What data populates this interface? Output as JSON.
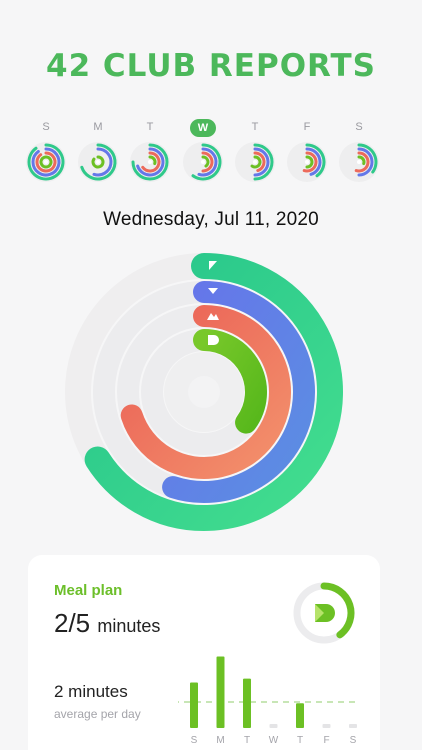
{
  "app": {
    "title": "42 CLUB REPORTS"
  },
  "week": {
    "days": [
      {
        "letter": "S",
        "active": false,
        "rings": [
          0.9,
          0.9,
          0.9,
          1.0
        ]
      },
      {
        "letter": "M",
        "active": false,
        "rings": [
          0.7,
          0.55,
          0.0,
          0.85
        ]
      },
      {
        "letter": "T",
        "active": false,
        "rings": [
          0.75,
          0.7,
          0.65,
          0.3
        ]
      },
      {
        "letter": "W",
        "active": true,
        "rings": [
          0.6,
          0.55,
          0.5,
          0.4
        ]
      },
      {
        "letter": "T",
        "active": false,
        "rings": [
          0.5,
          0.5,
          0.45,
          0.6
        ]
      },
      {
        "letter": "F",
        "active": false,
        "rings": [
          0.4,
          0.45,
          0.55,
          0.5
        ]
      },
      {
        "letter": "S",
        "active": false,
        "rings": [
          0.35,
          0.5,
          0.55,
          0.3
        ]
      }
    ]
  },
  "date_heading": "Wednesday, Jul 11, 2020",
  "activity": {
    "rings": [
      {
        "name": "outer",
        "fraction": 0.66,
        "color_start": "#25c48b",
        "color_end": "#3ddc8e"
      },
      {
        "name": "second",
        "fraction": 0.55,
        "color_start": "#6477e8",
        "color_end": "#5a8be0"
      },
      {
        "name": "third",
        "fraction": 0.7,
        "color_start": "#ec6a5b",
        "color_end": "#f2876a"
      },
      {
        "name": "inner",
        "fraction": 0.35,
        "color_start": "#6cc024",
        "color_end": "#56b81e"
      }
    ],
    "track_color": "#ececee"
  },
  "meal_card": {
    "label": "Meal plan",
    "value_main": "2/5",
    "value_unit": "minutes",
    "progress": 0.4,
    "avg_value": "2 minutes",
    "avg_caption": "average per day"
  },
  "chart_data": {
    "type": "bar",
    "categories": [
      "S",
      "M",
      "T",
      "W",
      "T",
      "F",
      "S"
    ],
    "values": [
      3.5,
      5.5,
      3.8,
      0,
      1.9,
      0,
      0
    ],
    "average": 2,
    "ylim": [
      0,
      6
    ],
    "xlabel": "",
    "ylabel": "",
    "color": "#6cc024"
  },
  "colors": {
    "brand_green": "#4cb85b",
    "accent_lime": "#6cc024"
  }
}
